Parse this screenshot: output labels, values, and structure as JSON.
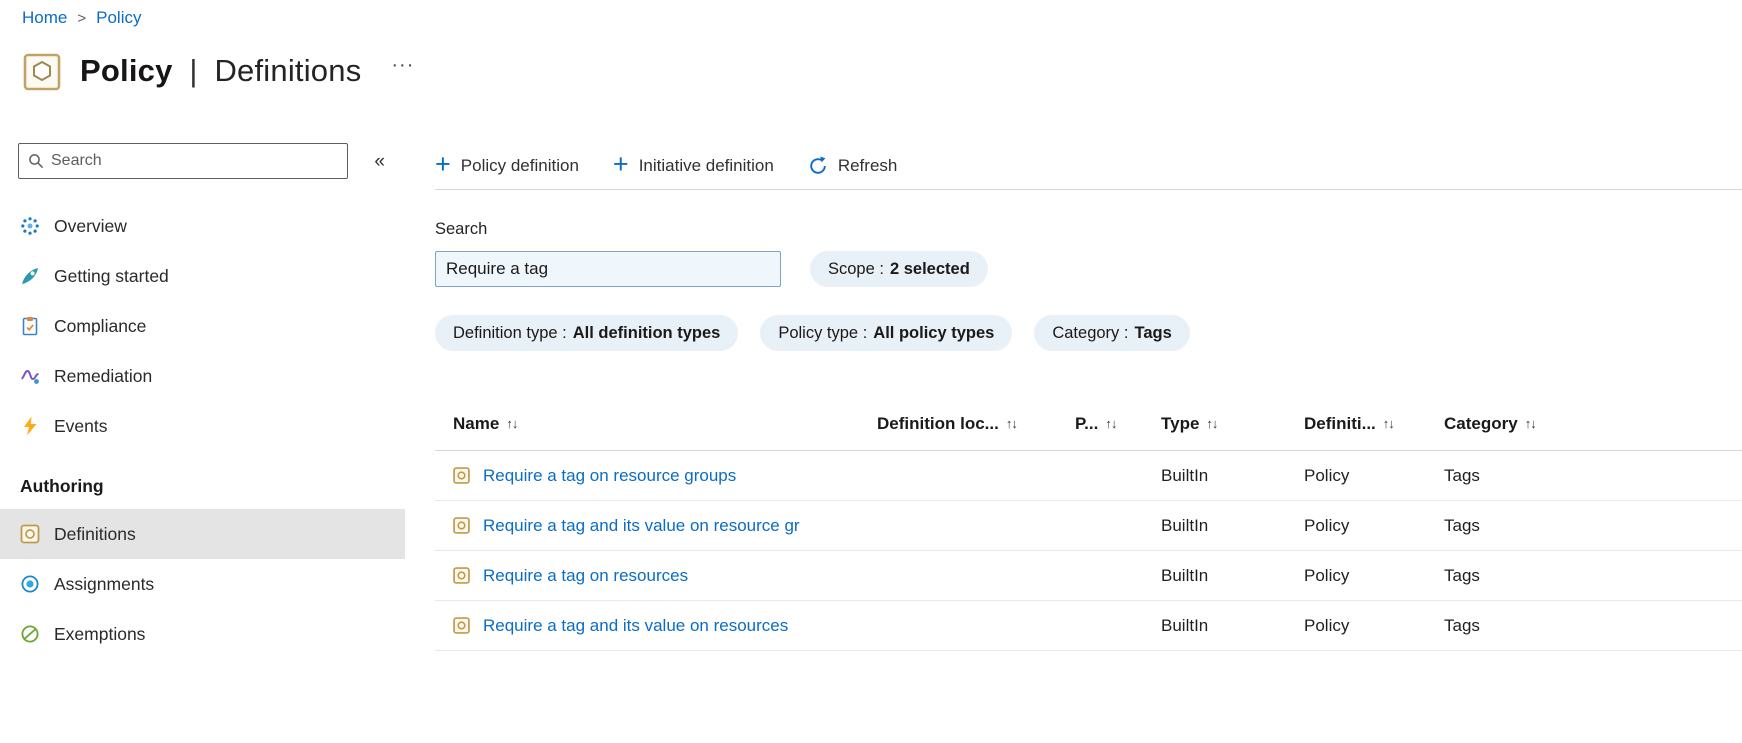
{
  "colors": {
    "link": "#0b6cc4",
    "accent": "#0078d4",
    "pill_background": "#e8f0f8",
    "filter_input_background": "#eff6fc",
    "selected_item_background": "#e4e4e4"
  },
  "icons": {
    "plus": "+",
    "sort": "↑↓",
    "collapse": "«",
    "more": "···",
    "breadcrumb_separator": ">"
  },
  "breadcrumb": {
    "items": [
      {
        "label": "Home"
      },
      {
        "label": "Policy"
      }
    ]
  },
  "header": {
    "title_primary": "Policy",
    "title_separator": "|",
    "title_secondary": "Definitions"
  },
  "sidebar": {
    "search_placeholder": "Search",
    "items": [
      {
        "label": "Overview"
      },
      {
        "label": "Getting started"
      },
      {
        "label": "Compliance"
      },
      {
        "label": "Remediation"
      },
      {
        "label": "Events"
      }
    ],
    "section_label": "Authoring",
    "authoring_items": [
      {
        "label": "Definitions",
        "selected": true
      },
      {
        "label": "Assignments",
        "selected": false
      },
      {
        "label": "Exemptions",
        "selected": false
      }
    ]
  },
  "toolbar": {
    "policy_definition_label": "Policy definition",
    "initiative_definition_label": "Initiative definition",
    "refresh_label": "Refresh"
  },
  "filters": {
    "search_label": "Search",
    "search_value": "Require a tag",
    "pills": [
      {
        "name": "Scope :",
        "value": "2 selected"
      },
      {
        "name": "Definition type :",
        "value": "All definition types"
      },
      {
        "name": "Policy type :",
        "value": "All policy types"
      },
      {
        "name": "Category :",
        "value": "Tags"
      }
    ]
  },
  "table": {
    "columns": [
      "Name",
      "Definition loc...",
      "P...",
      "Type",
      "Definiti...",
      "Category"
    ],
    "rows": [
      {
        "name": "Require a tag on resource groups",
        "definition_location": "",
        "p": "",
        "type": "BuiltIn",
        "definition_type": "Policy",
        "category": "Tags"
      },
      {
        "name": "Require a tag and its value on resource gr",
        "definition_location": "",
        "p": "",
        "type": "BuiltIn",
        "definition_type": "Policy",
        "category": "Tags"
      },
      {
        "name": "Require a tag on resources",
        "definition_location": "",
        "p": "",
        "type": "BuiltIn",
        "definition_type": "Policy",
        "category": "Tags"
      },
      {
        "name": "Require a tag and its value on resources",
        "definition_location": "",
        "p": "",
        "type": "BuiltIn",
        "definition_type": "Policy",
        "category": "Tags"
      }
    ]
  }
}
